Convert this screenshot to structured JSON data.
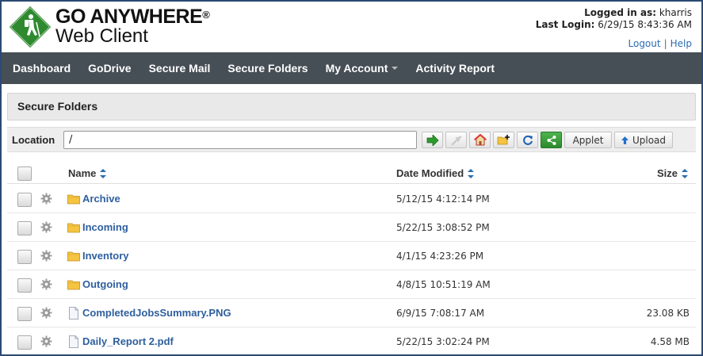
{
  "brand": {
    "main": "GO ANYWHERE",
    "reg": "®",
    "sub": "Web Client"
  },
  "user": {
    "logged_label": "Logged in as:",
    "username": "kharris",
    "last_login_label": "Last Login:",
    "last_login": "6/29/15 8:43:36 AM",
    "logout": "Logout",
    "separator": "|",
    "help": "Help"
  },
  "nav": {
    "items": [
      {
        "label": "Dashboard"
      },
      {
        "label": "GoDrive"
      },
      {
        "label": "Secure Mail"
      },
      {
        "label": "Secure Folders"
      },
      {
        "label": "My Account"
      },
      {
        "label": "Activity Report"
      }
    ]
  },
  "panel": {
    "title": "Secure Folders"
  },
  "location": {
    "label": "Location",
    "value": "/",
    "applet_label": "Applet",
    "upload_label": "Upload"
  },
  "table": {
    "columns": {
      "name": "Name",
      "date": "Date Modified",
      "size": "Size"
    },
    "rows": [
      {
        "type": "folder",
        "name": "Archive",
        "date": "5/12/15 4:12:14 PM",
        "size": ""
      },
      {
        "type": "folder",
        "name": "Incoming",
        "date": "5/22/15 3:08:52 PM",
        "size": ""
      },
      {
        "type": "folder",
        "name": "Inventory",
        "date": "4/1/15 4:23:26 PM",
        "size": ""
      },
      {
        "type": "folder",
        "name": "Outgoing",
        "date": "4/8/15 10:51:19 AM",
        "size": ""
      },
      {
        "type": "file",
        "name": "CompletedJobsSummary.PNG",
        "date": "6/9/15 7:08:17 AM",
        "size": "23.08 KB"
      },
      {
        "type": "file",
        "name": "Daily_Report 2.pdf",
        "date": "5/22/15 3:02:24 PM",
        "size": "4.58 MB"
      }
    ]
  },
  "colors": {
    "nav_bg": "#464e56",
    "link": "#2e5f9e",
    "logo_green": "#2f8a2f",
    "frame": "#2b4a73"
  }
}
